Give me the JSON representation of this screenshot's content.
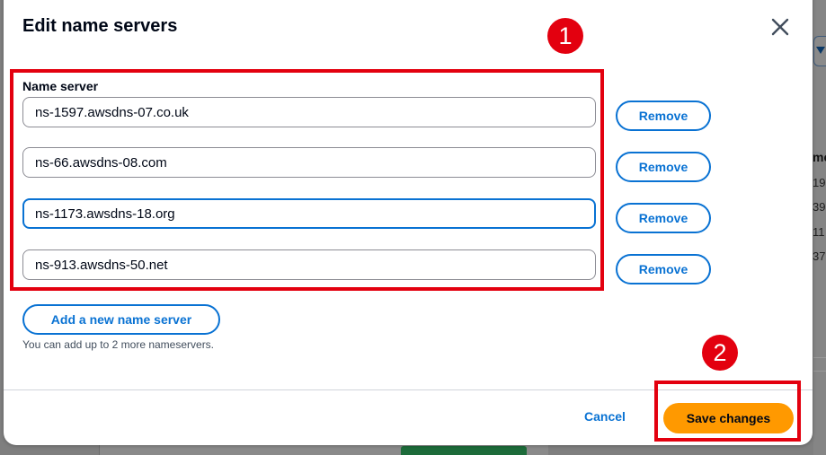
{
  "background": {
    "column_header": "me",
    "cells": [
      "19",
      "39",
      "11",
      "37"
    ]
  },
  "modal": {
    "title": "Edit name servers",
    "close_icon": "close-icon",
    "field_label": "Name server",
    "name_servers": [
      {
        "value": "ns-1597.awsdns-07.co.uk",
        "focused": false
      },
      {
        "value": "ns-66.awsdns-08.com",
        "focused": false
      },
      {
        "value": "ns-1173.awsdns-18.org",
        "focused": true
      },
      {
        "value": "ns-913.awsdns-50.net",
        "focused": false
      }
    ],
    "remove_label": "Remove",
    "add_label": "Add a new name server",
    "hint": "You can add up to 2 more nameservers.",
    "cancel_label": "Cancel",
    "save_label": "Save changes"
  },
  "annotations": {
    "badge_1": "1",
    "badge_2": "2",
    "color": "#e3000f"
  },
  "colors": {
    "accent": "#0972d3",
    "primary_button": "#ff9900",
    "overlay": "#7d7d7d"
  }
}
